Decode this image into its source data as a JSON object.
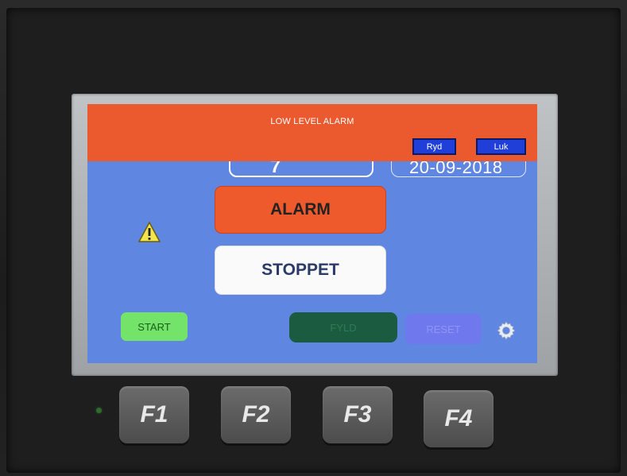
{
  "banner": {
    "title": "LOW LEVEL ALARM",
    "ryd_label": "Ryd",
    "luk_label": "Luk"
  },
  "readouts": {
    "left_value": "7",
    "right_value": "20-09-2018"
  },
  "status": {
    "alarm_label": "ALARM",
    "state_label": "STOPPET"
  },
  "controls": {
    "start_label": "START",
    "fyld_label": "FYLD",
    "reset_label": "RESET"
  },
  "function_keys": [
    "F1",
    "F2",
    "F3",
    "F4"
  ],
  "icons": {
    "warning": "warning-triangle-icon",
    "settings": "gear-icon",
    "led": "status-led"
  },
  "colors": {
    "screen_bg": "#5f86e0",
    "banner_bg": "#ea5a2e",
    "alarm_bg": "#ee5a2c",
    "start_bg": "#74e36a",
    "fyld_bg": "#1b5c40",
    "reset_bg": "#6f78ec",
    "small_button_bg": "#1f3fd8"
  }
}
